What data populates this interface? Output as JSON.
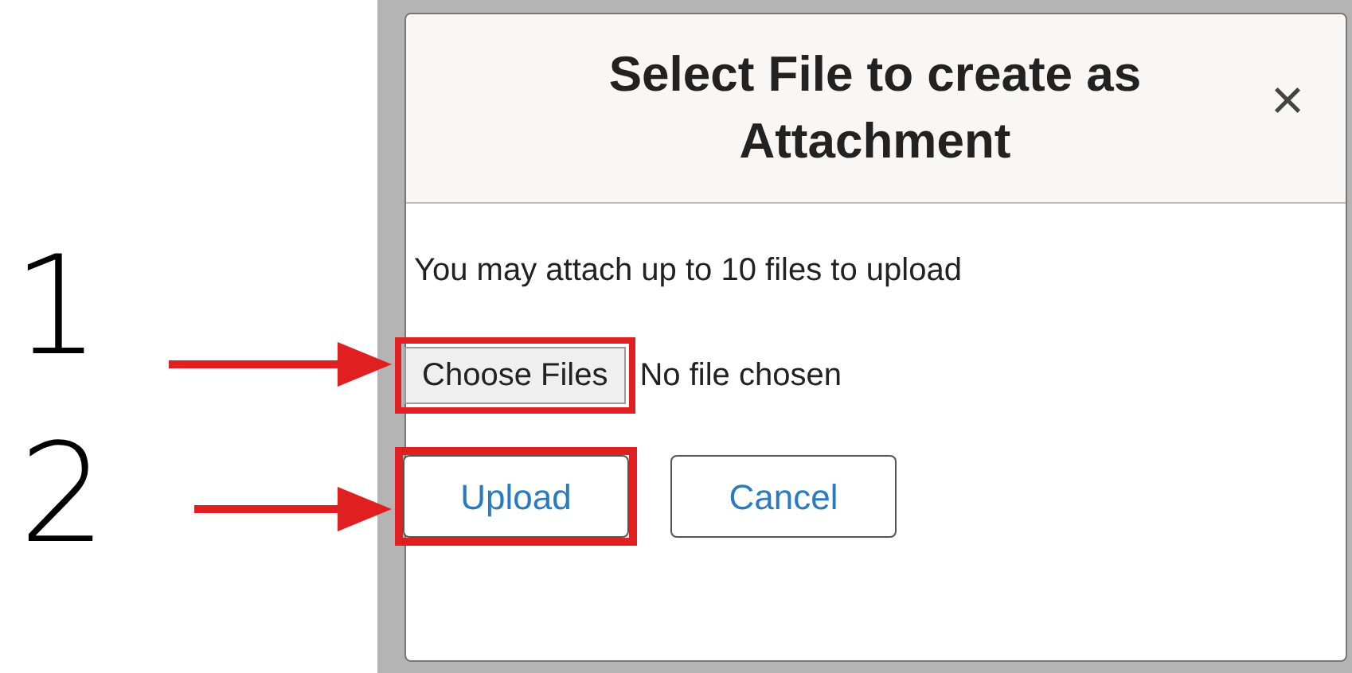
{
  "annotations": [
    {
      "label": "1"
    },
    {
      "label": "2"
    }
  ],
  "dialog": {
    "title": "Select File to create as Attachment",
    "close": "×",
    "message": "You may attach up to 10 files to upload",
    "file_input": {
      "button": "Choose Files",
      "status": "No file chosen",
      "highlighted": true
    },
    "buttons": [
      {
        "label": "Upload",
        "highlighted": true
      },
      {
        "label": "Cancel",
        "highlighted": false
      }
    ]
  }
}
